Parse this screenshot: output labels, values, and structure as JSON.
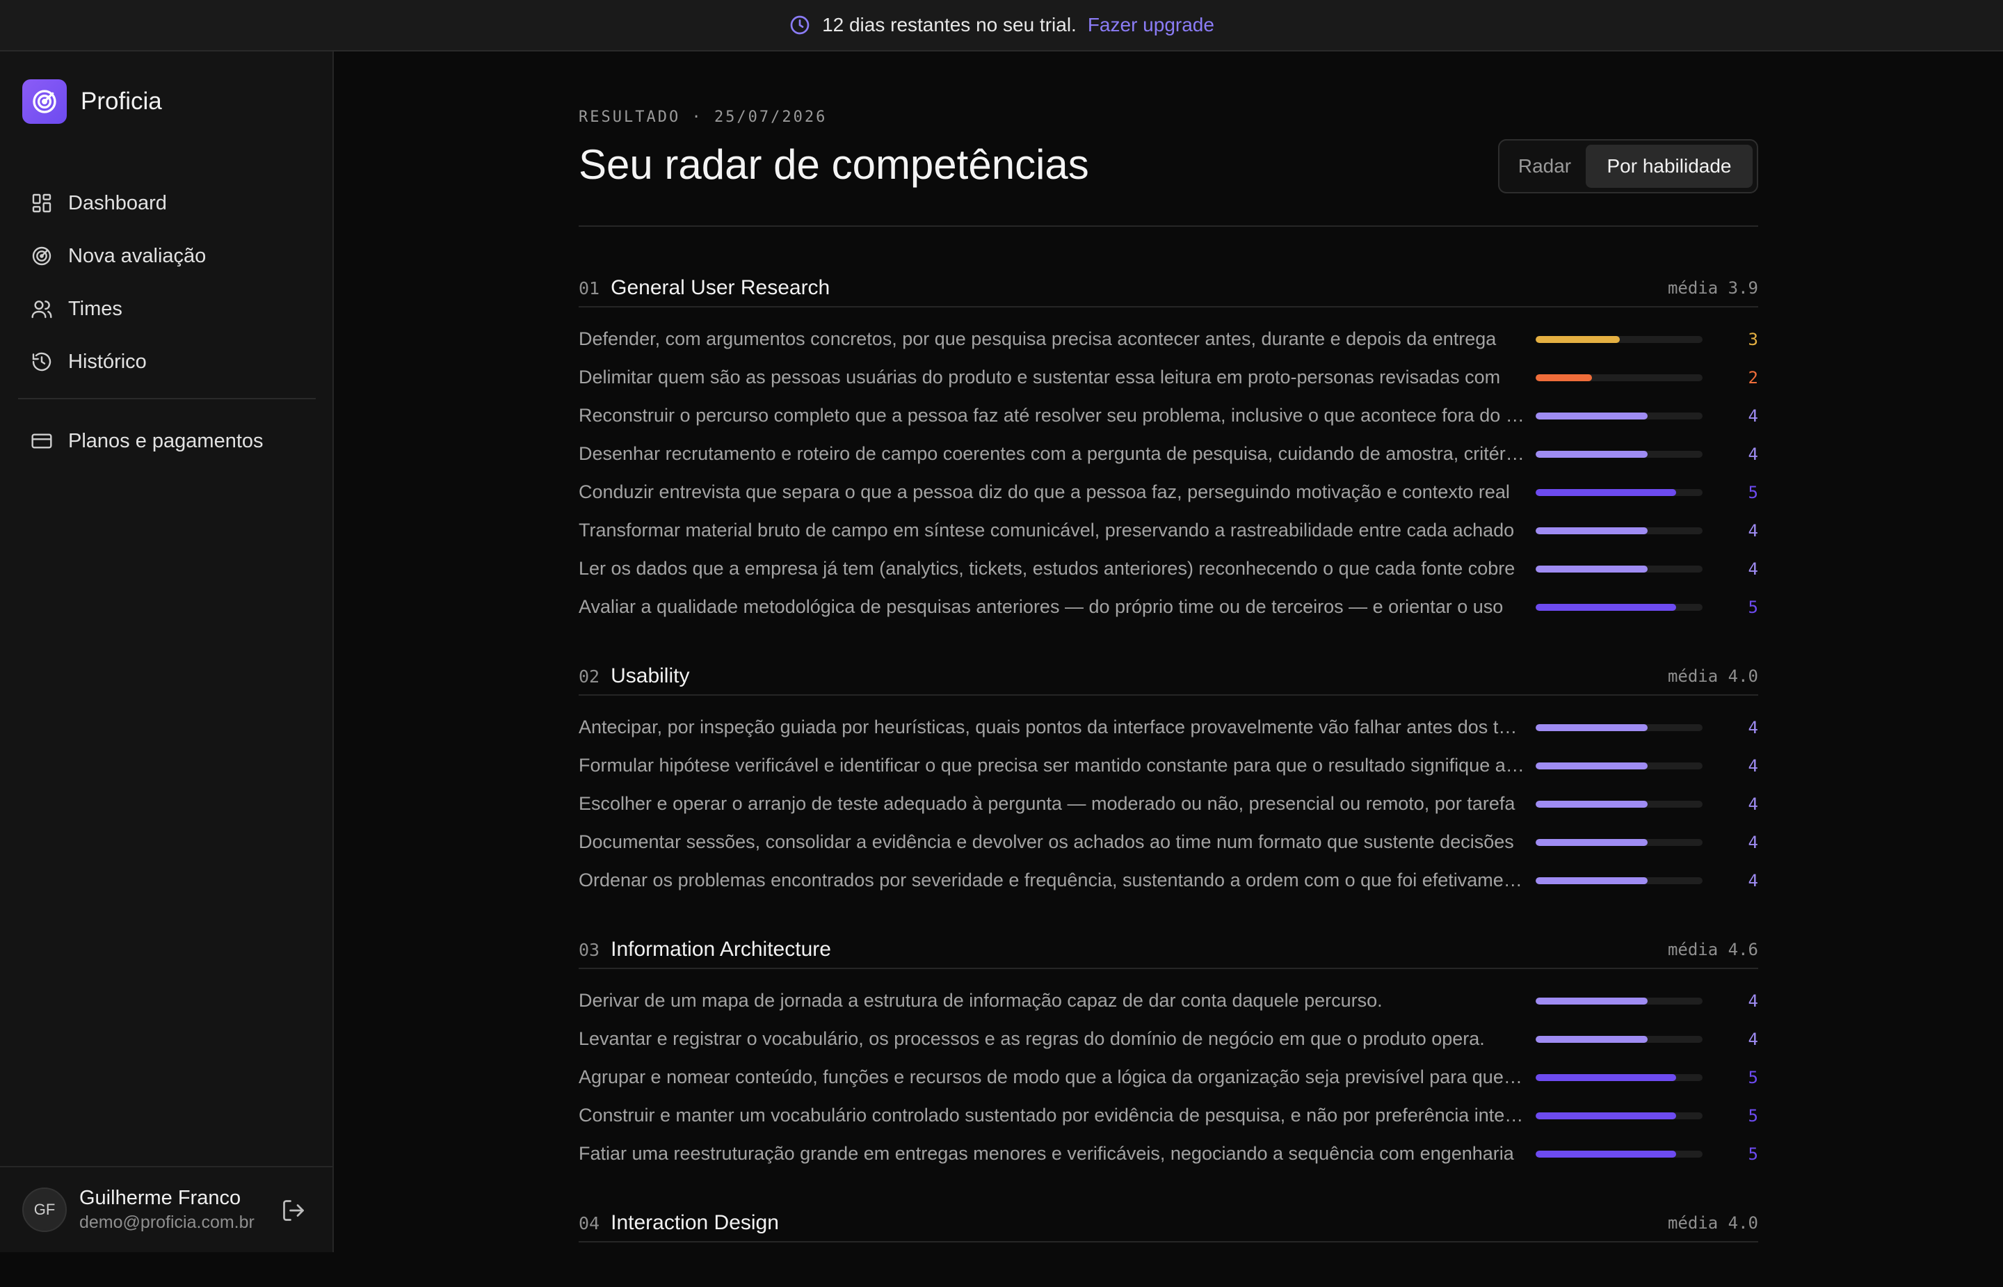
{
  "banner": {
    "text": "12 dias restantes no seu trial.",
    "link": "Fazer upgrade",
    "icon": "clock-icon",
    "link_color": "#8b7cf6"
  },
  "sidebar": {
    "brand": "Proficia",
    "items": [
      {
        "label": "Dashboard",
        "icon": "dashboard-icon"
      },
      {
        "label": "Nova avaliação",
        "icon": "target-icon"
      },
      {
        "label": "Times",
        "icon": "users-icon"
      },
      {
        "label": "Histórico",
        "icon": "history-icon"
      },
      {
        "label": "Planos e pagamentos",
        "icon": "credit-card-icon"
      }
    ],
    "user": {
      "initials": "GF",
      "name": "Guilherme Franco",
      "email": "demo@proficia.com.br"
    }
  },
  "main": {
    "eyebrow": "RESULTADO · 25/07/2026",
    "title": "Seu radar de competências",
    "toggle": {
      "radar": "Radar",
      "skill": "Por habilidade",
      "selected": "Por habilidade"
    },
    "score_max": 5,
    "colors": {
      "5": "#6d4bf0",
      "4": "#9f8cf3",
      "3": "#e5b042",
      "2": "#ef6d3a"
    },
    "sections": [
      {
        "num": "01",
        "title": "General User Research",
        "avg": "média 3.9",
        "skills": [
          {
            "text": "Defender, com argumentos concretos, por que pesquisa precisa acontecer antes, durante e depois da entrega",
            "score": 3
          },
          {
            "text": "Delimitar quem são as pessoas usuárias do produto e sustentar essa leitura em proto-personas revisadas com",
            "score": 2
          },
          {
            "text": "Reconstruir o percurso completo que a pessoa faz até resolver seu problema, inclusive o que acontece fora do produto",
            "score": 4
          },
          {
            "text": "Desenhar recrutamento e roteiro de campo coerentes com a pergunta de pesquisa, cuidando de amostra, critérios",
            "score": 4
          },
          {
            "text": "Conduzir entrevista que separa o que a pessoa diz do que a pessoa faz, perseguindo motivação e contexto real",
            "score": 5
          },
          {
            "text": "Transformar material bruto de campo em síntese comunicável, preservando a rastreabilidade entre cada achado",
            "score": 4
          },
          {
            "text": "Ler os dados que a empresa já tem (analytics, tickets, estudos anteriores) reconhecendo o que cada fonte cobre",
            "score": 4
          },
          {
            "text": "Avaliar a qualidade metodológica de pesquisas anteriores — do próprio time ou de terceiros — e orientar o uso",
            "score": 5
          }
        ]
      },
      {
        "num": "02",
        "title": "Usability",
        "avg": "média 4.0",
        "skills": [
          {
            "text": "Antecipar, por inspeção guiada por heurísticas, quais pontos da interface provavelmente vão falhar antes dos testes",
            "score": 4
          },
          {
            "text": "Formular hipótese verificável e identificar o que precisa ser mantido constante para que o resultado signifique algo",
            "score": 4
          },
          {
            "text": "Escolher e operar o arranjo de teste adequado à pergunta — moderado ou não, presencial ou remoto, por tarefa",
            "score": 4
          },
          {
            "text": "Documentar sessões, consolidar a evidência e devolver os achados ao time num formato que sustente decisões",
            "score": 4
          },
          {
            "text": "Ordenar os problemas encontrados por severidade e frequência, sustentando a ordem com o que foi efetivamente observado",
            "score": 4
          }
        ]
      },
      {
        "num": "03",
        "title": "Information Architecture",
        "avg": "média 4.6",
        "skills": [
          {
            "text": "Derivar de um mapa de jornada a estrutura de informação capaz de dar conta daquele percurso.",
            "score": 4
          },
          {
            "text": "Levantar e registrar o vocabulário, os processos e as regras do domínio de negócio em que o produto opera.",
            "score": 4
          },
          {
            "text": "Agrupar e nomear conteúdo, funções e recursos de modo que a lógica da organização seja previsível para quem usa",
            "score": 5
          },
          {
            "text": "Construir e manter um vocabulário controlado sustentado por evidência de pesquisa, e não por preferência interna",
            "score": 5
          },
          {
            "text": "Fatiar uma reestruturação grande em entregas menores e verificáveis, negociando a sequência com engenharia",
            "score": 5
          }
        ]
      },
      {
        "num": "04",
        "title": "Interaction Design",
        "avg": "média 4.0",
        "skills": []
      }
    ]
  }
}
